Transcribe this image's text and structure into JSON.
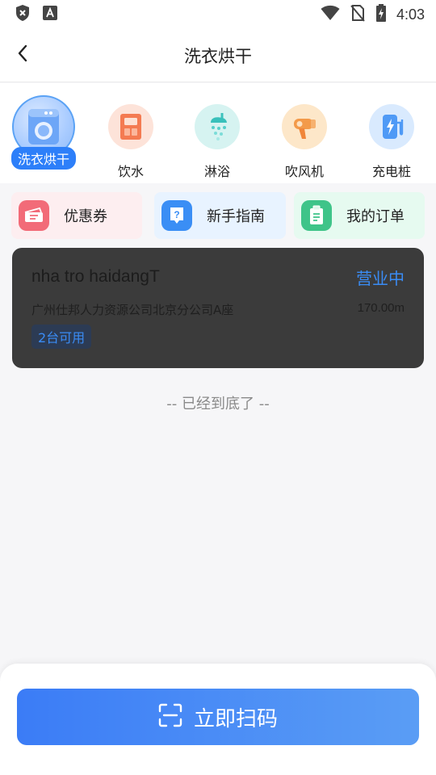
{
  "status_bar": {
    "time": "4:03",
    "icons": [
      "shield-icon",
      "font-icon",
      "wifi-icon",
      "no-sim-icon",
      "battery-charging-icon"
    ]
  },
  "header": {
    "title": "洗衣烘干",
    "back_icon": "chevron-left-icon"
  },
  "categories": [
    {
      "label": "洗衣烘干",
      "icon": "washing-machine-icon",
      "active": true
    },
    {
      "label": "饮水",
      "icon": "water-dispenser-icon",
      "active": false
    },
    {
      "label": "淋浴",
      "icon": "shower-icon",
      "active": false
    },
    {
      "label": "吹风机",
      "icon": "hair-dryer-icon",
      "active": false
    },
    {
      "label": "充电桩",
      "icon": "charging-pile-icon",
      "active": false
    }
  ],
  "shortcuts": [
    {
      "label": "优惠券",
      "icon": "coupon-icon",
      "bg": "#fdeef0",
      "icon_bg": "#f26b78"
    },
    {
      "label": "新手指南",
      "icon": "help-icon",
      "bg": "#e8f3ff",
      "icon_bg": "#3a8ef5"
    },
    {
      "label": "我的订单",
      "icon": "order-icon",
      "bg": "#e6faf0",
      "icon_bg": "#3fc489"
    }
  ],
  "store": {
    "name": "nha tro haidangT",
    "status": "营业中",
    "address": "广州仕邦人力资源公司北京分公司A座",
    "distance": "170.00m",
    "available": "2台可用"
  },
  "end_note": "-- 已经到底了 --",
  "scan": {
    "label": "立即扫码",
    "icon": "scan-icon"
  },
  "colors": {
    "accent": "#2d7ff9",
    "store_card_bg": "#3b3b3b"
  }
}
